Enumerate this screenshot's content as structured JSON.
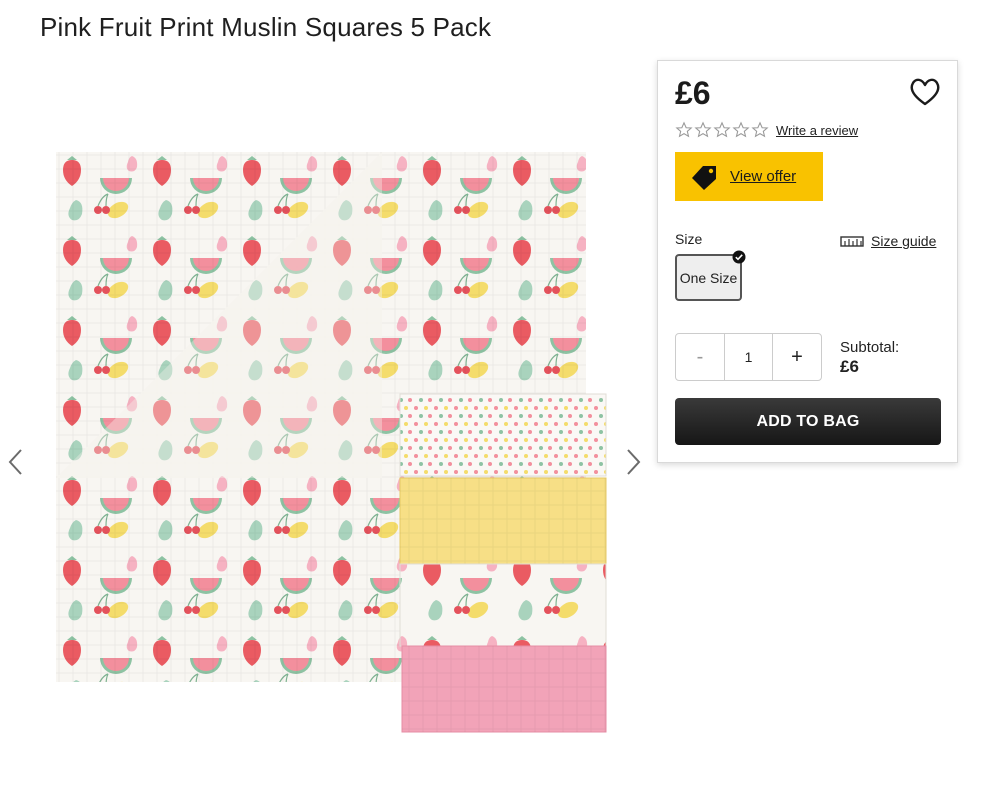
{
  "product": {
    "title": "Pink Fruit Print Muslin Squares 5 Pack",
    "price": "£6",
    "review_link": "Write a review",
    "offer_label": "View offer",
    "size_label": "Size",
    "size_guide_label": "Size guide",
    "size_option": "One Size",
    "quantity": {
      "minus": "-",
      "value": "1",
      "plus": "+"
    },
    "subtotal_label": "Subtotal:",
    "subtotal_value": "£6",
    "add_to_bag_label": "ADD TO BAG"
  },
  "colors": {
    "offer_yellow": "#f9c200",
    "button_dark": "#1e1e1e",
    "muslin_pink": "#f2a3b8",
    "muslin_yellow": "#f7df86",
    "muslin_white": "#f8f6f2"
  },
  "icons": {
    "wishlist": "heart-outline-icon",
    "offer": "price-tag-icon",
    "size_guide": "ruler-icon",
    "selected": "check-circle-icon",
    "prev": "chevron-left-icon",
    "next": "chevron-right-icon"
  }
}
